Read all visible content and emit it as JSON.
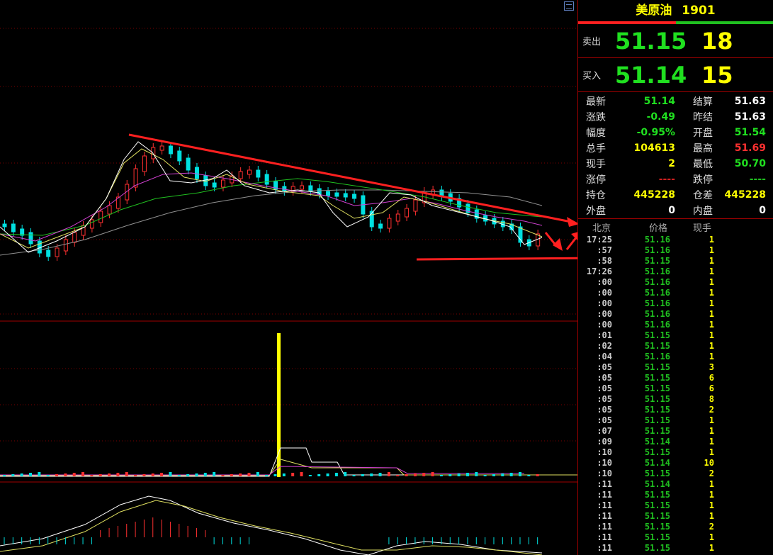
{
  "header": {
    "name": "美原油",
    "code": "1901"
  },
  "quotes": [
    {
      "label": "卖出",
      "price": "51.15",
      "volume": "18"
    },
    {
      "label": "买入",
      "price": "51.14",
      "volume": "15"
    }
  ],
  "stats": [
    {
      "k1": "最新",
      "v1": "51.14",
      "c1": "green",
      "k2": "结算",
      "v2": "51.63",
      "c2": "white"
    },
    {
      "k1": "涨跌",
      "v1": "-0.49",
      "c1": "green",
      "k2": "昨结",
      "v2": "51.63",
      "c2": "white"
    },
    {
      "k1": "幅度",
      "v1": "-0.95%",
      "c1": "green",
      "k2": "开盘",
      "v2": "51.54",
      "c2": "green"
    },
    {
      "k1": "总手",
      "v1": "104613",
      "c1": "yellow",
      "k2": "最高",
      "v2": "51.69",
      "c2": "red"
    },
    {
      "k1": "现手",
      "v1": "2",
      "c1": "yellow",
      "k2": "最低",
      "v2": "50.70",
      "c2": "green"
    },
    {
      "k1": "涨停",
      "v1": "----",
      "c1": "dred",
      "k2": "跌停",
      "v2": "----",
      "c2": "dgreen"
    },
    {
      "k1": "持仓",
      "v1": "445228",
      "c1": "yellow",
      "k2": "仓差",
      "v2": "445228",
      "c2": "yellow"
    },
    {
      "k1": "外盘",
      "v1": "0",
      "c1": "white",
      "k2": "内盘",
      "v2": "0",
      "c2": "white"
    }
  ],
  "ticks_header": {
    "time": "北京",
    "price": "价格",
    "volume": "现手"
  },
  "ticks": [
    {
      "t": "17:25",
      "p": "51.16",
      "v": "1"
    },
    {
      "t": ":57",
      "p": "51.16",
      "v": "1"
    },
    {
      "t": ":58",
      "p": "51.15",
      "v": "1"
    },
    {
      "t": "17:26",
      "p": "51.16",
      "v": "1"
    },
    {
      "t": ":00",
      "p": "51.16",
      "v": "1"
    },
    {
      "t": ":00",
      "p": "51.16",
      "v": "1"
    },
    {
      "t": ":00",
      "p": "51.16",
      "v": "1"
    },
    {
      "t": ":00",
      "p": "51.16",
      "v": "1"
    },
    {
      "t": ":00",
      "p": "51.16",
      "v": "1"
    },
    {
      "t": ":01",
      "p": "51.15",
      "v": "1"
    },
    {
      "t": ":02",
      "p": "51.15",
      "v": "1"
    },
    {
      "t": ":04",
      "p": "51.16",
      "v": "1"
    },
    {
      "t": ":05",
      "p": "51.15",
      "v": "3"
    },
    {
      "t": ":05",
      "p": "51.15",
      "v": "6"
    },
    {
      "t": ":05",
      "p": "51.15",
      "v": "6"
    },
    {
      "t": ":05",
      "p": "51.15",
      "v": "8"
    },
    {
      "t": ":05",
      "p": "51.15",
      "v": "2"
    },
    {
      "t": ":05",
      "p": "51.15",
      "v": "1"
    },
    {
      "t": ":07",
      "p": "51.15",
      "v": "1"
    },
    {
      "t": ":09",
      "p": "51.14",
      "v": "1"
    },
    {
      "t": ":10",
      "p": "51.15",
      "v": "1"
    },
    {
      "t": ":10",
      "p": "51.14",
      "v": "10"
    },
    {
      "t": ":10",
      "p": "51.15",
      "v": "2"
    },
    {
      "t": ":11",
      "p": "51.14",
      "v": "1"
    },
    {
      "t": ":11",
      "p": "51.15",
      "v": "1"
    },
    {
      "t": ":11",
      "p": "51.15",
      "v": "1"
    },
    {
      "t": ":11",
      "p": "51.15",
      "v": "1"
    },
    {
      "t": ":11",
      "p": "51.15",
      "v": "2"
    },
    {
      "t": ":11",
      "p": "51.15",
      "v": "1"
    },
    {
      "t": ":11",
      "p": "51.15",
      "v": "1"
    }
  ],
  "colors": {
    "up": "#ff3030",
    "down": "#00e0e0",
    "grid": "#7a0000",
    "volume_spike": "#ffff00"
  }
}
